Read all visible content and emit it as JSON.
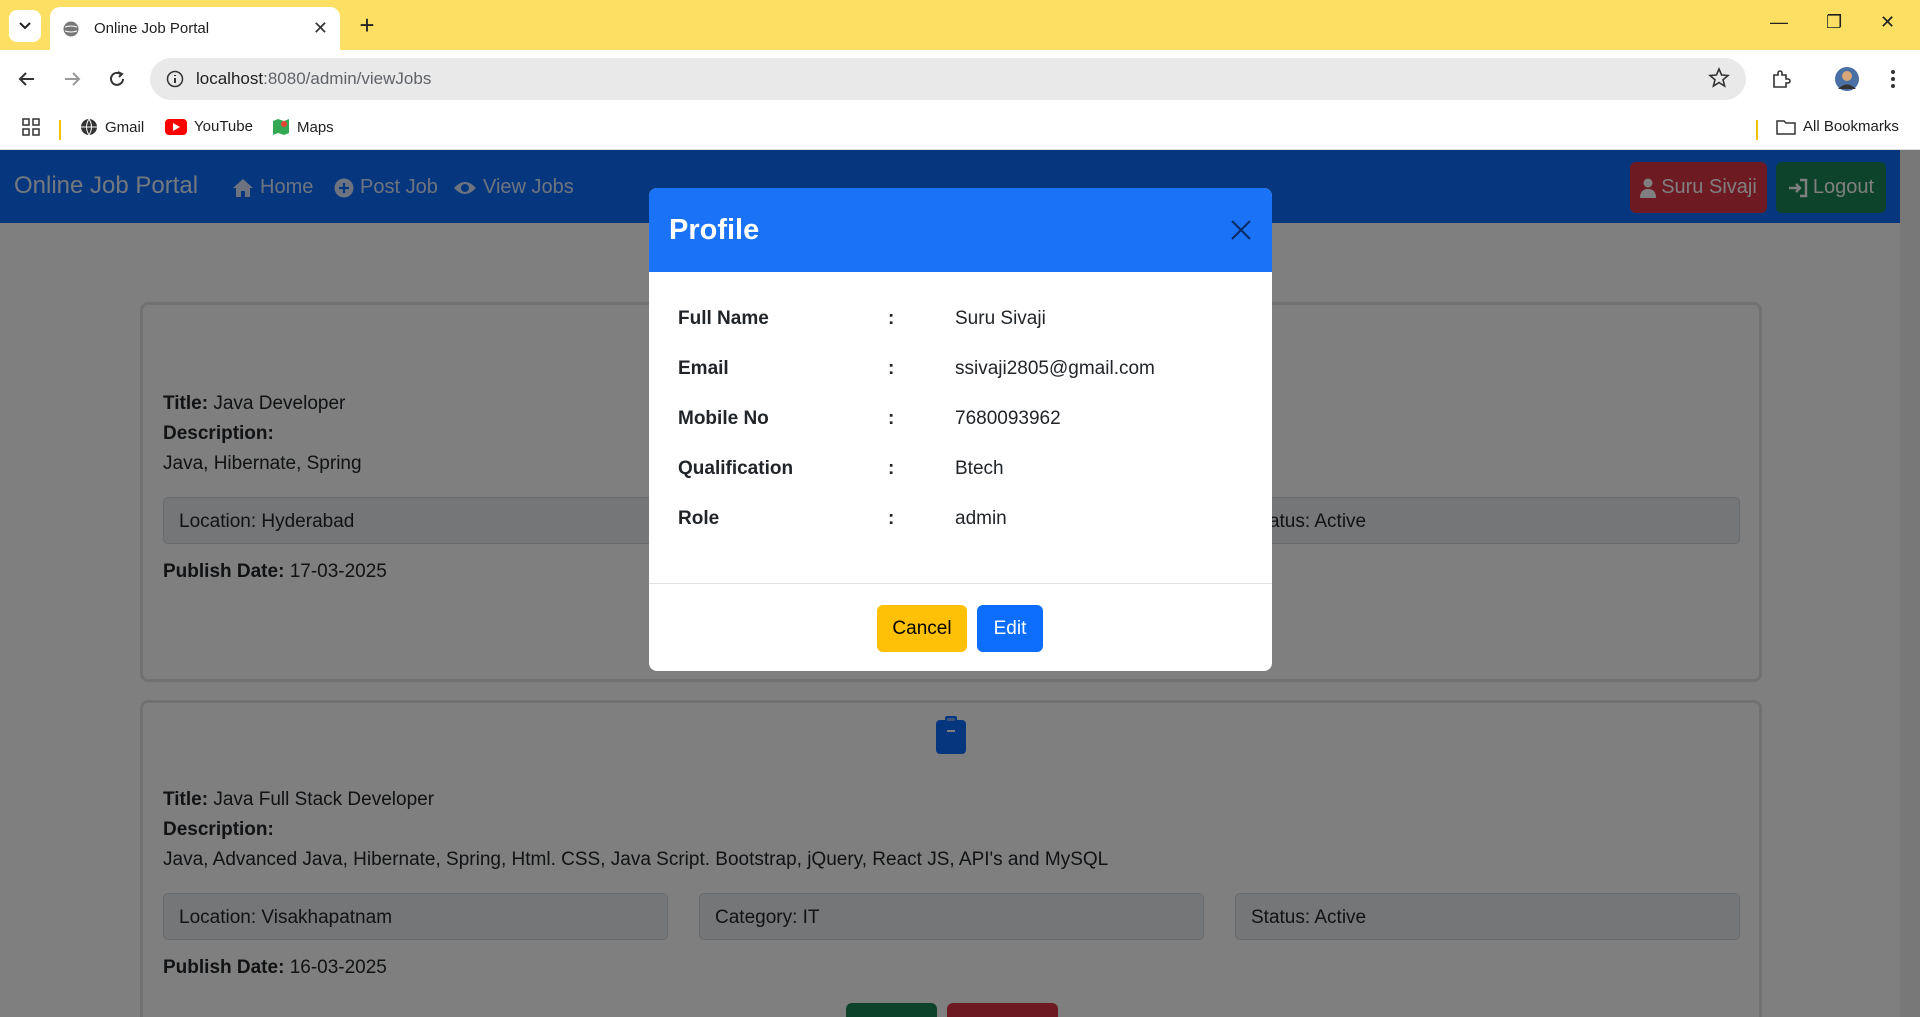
{
  "browser": {
    "tab_title": "Online Job Portal",
    "url_host": "localhost",
    "url_path": ":8080/admin/viewJobs",
    "bookmarks": [
      "Gmail",
      "YouTube",
      "Maps"
    ],
    "all_bookmarks": "All Bookmarks"
  },
  "navbar": {
    "brand": "Online Job Portal",
    "links": [
      "Home",
      "Post Job",
      "View Jobs"
    ],
    "user_button": "Suru Sivaji",
    "logout_button": "Logout"
  },
  "jobs": [
    {
      "title_label": "Title:",
      "title": "Java Developer",
      "description_label": "Description:",
      "description": "Java, Hibernate, Spring",
      "location": "Location: Hyderabad",
      "status": "Status: Active",
      "publish_label": "Publish Date:",
      "publish_date": "17-03-2025"
    },
    {
      "title_label": "Title:",
      "title": "Java Full Stack Developer",
      "description_label": "Description:",
      "description": "Java, Advanced Java, Hibernate, Spring, Html. CSS, Java Script. Bootstrap, jQuery, React JS, API's and MySQL",
      "location": "Location: Visakhapatnam",
      "category": "Category: IT",
      "status": "Status: Active",
      "publish_label": "Publish Date:",
      "publish_date": "16-03-2025"
    }
  ],
  "modal": {
    "title": "Profile",
    "colon": ":",
    "rows": [
      {
        "label": "Full Name",
        "value": "Suru Sivaji"
      },
      {
        "label": "Email",
        "value": "ssivaji2805@gmail.com"
      },
      {
        "label": "Mobile No",
        "value": "7680093962"
      },
      {
        "label": "Qualification",
        "value": "Btech"
      },
      {
        "label": "Role",
        "value": "admin"
      }
    ],
    "cancel": "Cancel",
    "edit": "Edit"
  },
  "colors": {
    "navbar": "#0d6efd",
    "danger": "#dc3545",
    "success": "#198754",
    "warning": "#ffc107",
    "chrome_tabbar": "#fde063"
  }
}
